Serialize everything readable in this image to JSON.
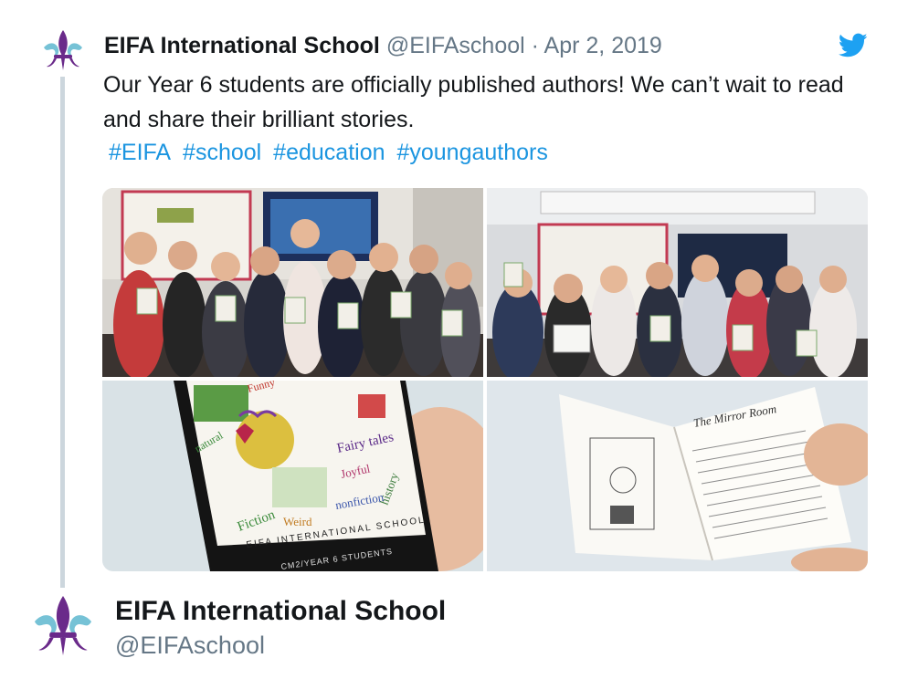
{
  "tweet": {
    "author_name": "EIFA International School",
    "handle": "@EIFAschool",
    "separator": "·",
    "date": "Apr 2, 2019",
    "text": "Our Year 6 students are officially published authors! We can’t wait to read and share their brilliant stories.",
    "hashtags": [
      "#EIFA",
      "#school",
      "#education",
      "#youngauthors"
    ],
    "icons": {
      "logo": "fleur-de-lis-icon",
      "platform": "twitter-bird-icon"
    },
    "media": {
      "photos": [
        {
          "name": "class-photo-1",
          "alt": "Year 6 students holding their books"
        },
        {
          "name": "class-photo-2",
          "alt": "Second group of students holding their books"
        },
        {
          "name": "book-cover-photo",
          "alt": "Hand holding the book cover"
        },
        {
          "name": "book-open-photo",
          "alt": "Open book showing a story page"
        }
      ],
      "book_cover_title": "EIFA INTERNATIONAL SCHOOL",
      "book_cover_subtitle": "CM2/YEAR 6 STUDENTS",
      "cover_words": [
        "Fairy tales",
        "Joyful",
        "history",
        "Fiction",
        "Weird",
        "nonfiction",
        "natural",
        "Funny"
      ],
      "open_book_heading": "The Mirror Room"
    }
  },
  "profile": {
    "name": "EIFA International School",
    "handle": "@EIFAschool"
  },
  "colors": {
    "link": "#1b95e0",
    "muted": "#657786",
    "text": "#14171a",
    "thread_line": "#ccd6dd"
  }
}
